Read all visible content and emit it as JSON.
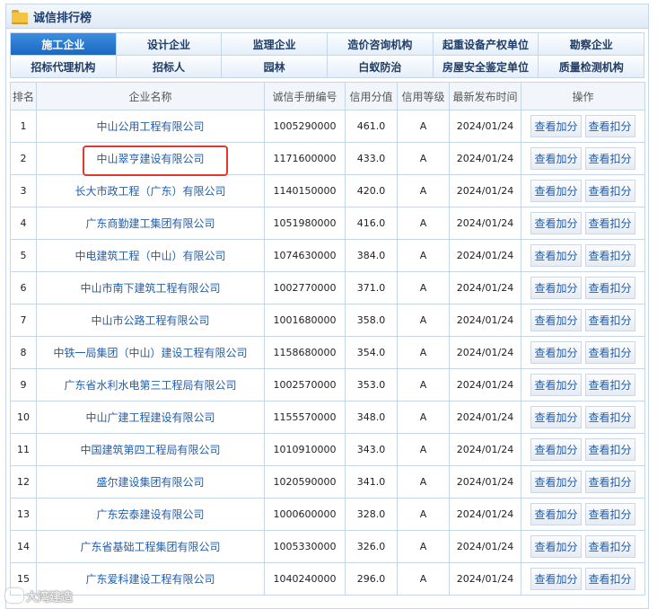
{
  "header": {
    "title": "诚信排行榜",
    "icon": "folder-icon"
  },
  "tabs": {
    "row1": [
      "施工企业",
      "设计企业",
      "监理企业",
      "造价咨询机构",
      "起重设备产权单位",
      "勘察企业"
    ],
    "row2": [
      "招标代理机构",
      "招标人",
      "园林",
      "白蚁防治",
      "房屋安全鉴定单位",
      "质量检测机构"
    ],
    "active_index": 0
  },
  "table": {
    "headers": [
      "排名",
      "企业名称",
      "诚信手册编号",
      "信用分值",
      "信用等级",
      "最新发布时间",
      "操作"
    ],
    "button_add": "查看加分",
    "button_deduct": "查看扣分",
    "rows": [
      {
        "rank": "1",
        "name": "中山公用工程有限公司",
        "code": "1005290000",
        "score": "461.0",
        "grade": "A",
        "date": "2024/01/24"
      },
      {
        "rank": "2",
        "name": "中山翠亨建设有限公司",
        "code": "1171600000",
        "score": "433.0",
        "grade": "A",
        "date": "2024/01/24"
      },
      {
        "rank": "3",
        "name": "长大市政工程（广东）有限公司",
        "code": "1140150000",
        "score": "420.0",
        "grade": "A",
        "date": "2024/01/24"
      },
      {
        "rank": "4",
        "name": "广东商勤建工集团有限公司",
        "code": "1051980000",
        "score": "416.0",
        "grade": "A",
        "date": "2024/01/24"
      },
      {
        "rank": "5",
        "name": "中电建筑工程（中山）有限公司",
        "code": "1074630000",
        "score": "384.0",
        "grade": "A",
        "date": "2024/01/24"
      },
      {
        "rank": "6",
        "name": "中山市南下建筑工程有限公司",
        "code": "1002770000",
        "score": "371.0",
        "grade": "A",
        "date": "2024/01/24"
      },
      {
        "rank": "7",
        "name": "中山市公路工程有限公司",
        "code": "1001680000",
        "score": "358.0",
        "grade": "A",
        "date": "2024/01/24"
      },
      {
        "rank": "8",
        "name": "中铁一局集团（中山）建设工程有限公司",
        "code": "1158680000",
        "score": "354.0",
        "grade": "A",
        "date": "2024/01/24"
      },
      {
        "rank": "9",
        "name": "广东省水利水电第三工程局有限公司",
        "code": "1002570000",
        "score": "353.0",
        "grade": "A",
        "date": "2024/01/24"
      },
      {
        "rank": "10",
        "name": "中山广建工程建设有限公司",
        "code": "1155570000",
        "score": "348.0",
        "grade": "A",
        "date": "2024/01/24"
      },
      {
        "rank": "11",
        "name": "中国建筑第四工程局有限公司",
        "code": "1010910000",
        "score": "343.0",
        "grade": "A",
        "date": "2024/01/24"
      },
      {
        "rank": "12",
        "name": "盛尔建设集团有限公司",
        "code": "1020590000",
        "score": "341.0",
        "grade": "A",
        "date": "2024/01/24"
      },
      {
        "rank": "13",
        "name": "广东宏泰建设有限公司",
        "code": "1000600000",
        "score": "328.0",
        "grade": "A",
        "date": "2024/01/24"
      },
      {
        "rank": "14",
        "name": "广东省基础工程集团有限公司",
        "code": "1005330000",
        "score": "326.0",
        "grade": "A",
        "date": "2024/01/24"
      },
      {
        "rank": "15",
        "name": "广东爱科建设工程有限公司",
        "code": "1040240000",
        "score": "296.0",
        "grade": "A",
        "date": "2024/01/24"
      }
    ]
  },
  "highlight_row_rank": "2",
  "watermark": "大湾建造",
  "colors": {
    "active_tab": "#1b67c2",
    "link": "#1f5fae",
    "highlight_border": "#e03a2f"
  }
}
